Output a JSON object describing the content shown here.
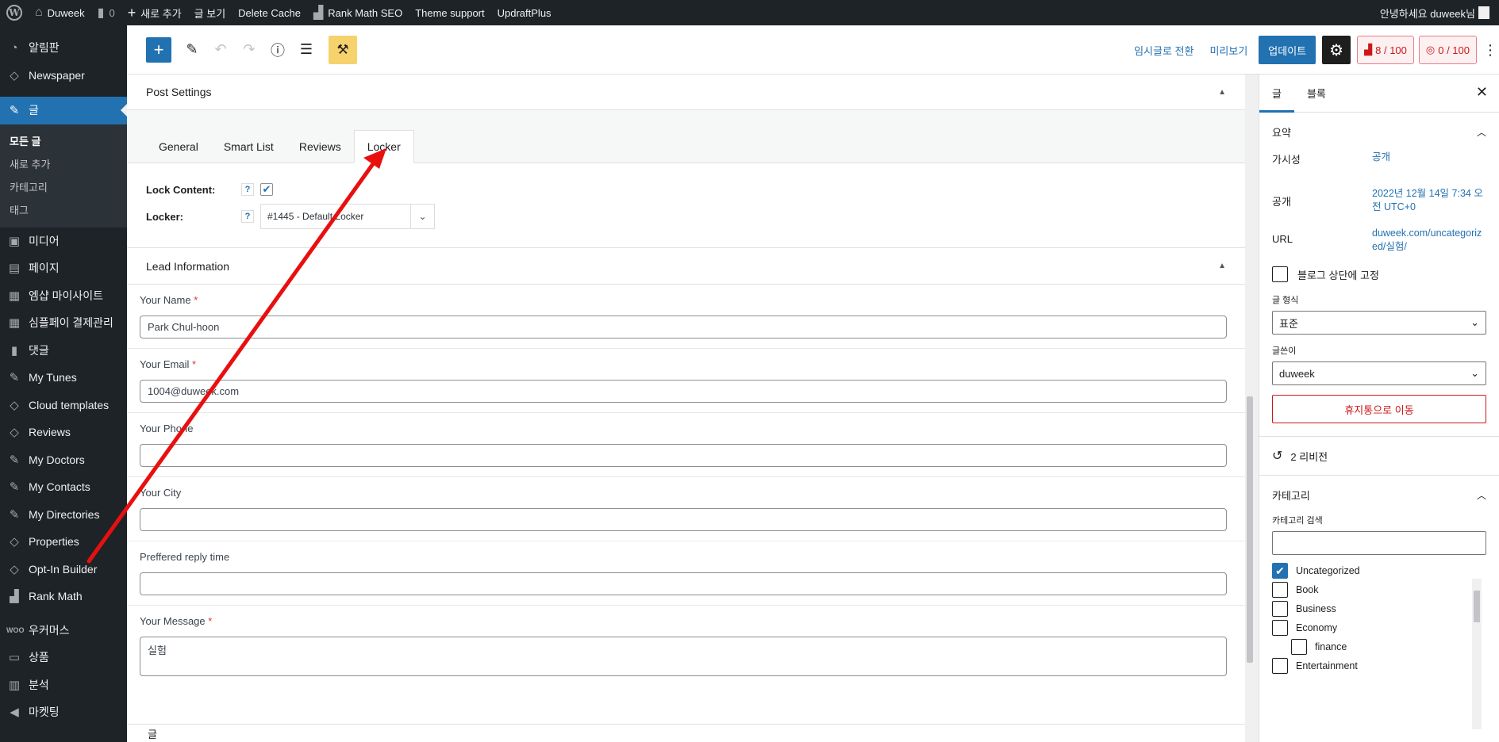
{
  "adminbar": {
    "site": "Duweek",
    "comments": "0",
    "new": "새로 추가",
    "view": "글 보기",
    "cache": "Delete Cache",
    "rankmath": "Rank Math SEO",
    "theme": "Theme support",
    "updraft": "UpdraftPlus",
    "greeting": "안녕하세요 duweek님"
  },
  "sidebar": {
    "items": [
      {
        "label": "알림판"
      },
      {
        "label": "Newspaper"
      },
      {
        "label": "글"
      },
      {
        "label": "미디어"
      },
      {
        "label": "페이지"
      },
      {
        "label": "엠샵 마이사이트"
      },
      {
        "label": "심플페이 결제관리"
      },
      {
        "label": "댓글"
      },
      {
        "label": "My Tunes"
      },
      {
        "label": "Cloud templates"
      },
      {
        "label": "Reviews"
      },
      {
        "label": "My Doctors"
      },
      {
        "label": "My Contacts"
      },
      {
        "label": "My Directories"
      },
      {
        "label": "Properties"
      },
      {
        "label": "Opt-In Builder"
      },
      {
        "label": "Rank Math"
      },
      {
        "label": "우커머스"
      },
      {
        "label": "상품"
      },
      {
        "label": "분석"
      },
      {
        "label": "마켓팅"
      }
    ],
    "submenu": [
      "모든 글",
      "새로 추가",
      "카테고리",
      "태그"
    ]
  },
  "toolbar": {
    "draft": "임시글로 전환",
    "preview": "미리보기",
    "update": "업데이트",
    "seo_score": "8 / 100",
    "readability": "0 / 100"
  },
  "post_settings": {
    "title": "Post Settings",
    "tabs": [
      "General",
      "Smart List",
      "Reviews",
      "Locker"
    ],
    "lock_content_label": "Lock Content:",
    "locker_label": "Locker:",
    "locker_value": "#1445 - Default Locker",
    "help": "?"
  },
  "lead": {
    "title": "Lead Information",
    "fields": [
      {
        "label": "Your Name",
        "required": "*",
        "value": "Park Chul-hoon"
      },
      {
        "label": "Your Email",
        "required": "*",
        "value": "1004@duweek.com"
      },
      {
        "label": "Your Phone",
        "required": "",
        "value": ""
      },
      {
        "label": "Your City",
        "required": "",
        "value": ""
      },
      {
        "label": "Preffered reply time",
        "required": "",
        "value": ""
      },
      {
        "label": "Your Message",
        "required": "*",
        "value": "실험"
      }
    ]
  },
  "footer": "글",
  "right": {
    "tab_post": "글",
    "tab_block": "블록",
    "summary": "요약",
    "visibility_k": "가시성",
    "visibility_v": "공개",
    "publish_k": "공개",
    "publish_v": "2022년 12월 14일 7:34 오전 UTC+0",
    "url_k": "URL",
    "url_v": "duweek.com/uncategorized/실험/",
    "sticky": "블로그 상단에 고정",
    "format_label": "글 형식",
    "format_value": "표준",
    "author_label": "글쓴이",
    "author_value": "duweek",
    "trash": "휴지통으로 이동",
    "revisions": "2 리비전",
    "categories": "카테고리",
    "cat_search": "카테고리 검색",
    "cats": [
      {
        "name": "Uncategorized",
        "checked": true
      },
      {
        "name": "Book",
        "checked": false
      },
      {
        "name": "Business",
        "checked": false
      },
      {
        "name": "Economy",
        "checked": false
      },
      {
        "name": "finance",
        "checked": false,
        "child": true
      },
      {
        "name": "Entertainment",
        "checked": false
      }
    ]
  },
  "colors": {
    "accent": "#2271b1",
    "arrow": "#e8100f",
    "adminbar": "#1d2327"
  }
}
